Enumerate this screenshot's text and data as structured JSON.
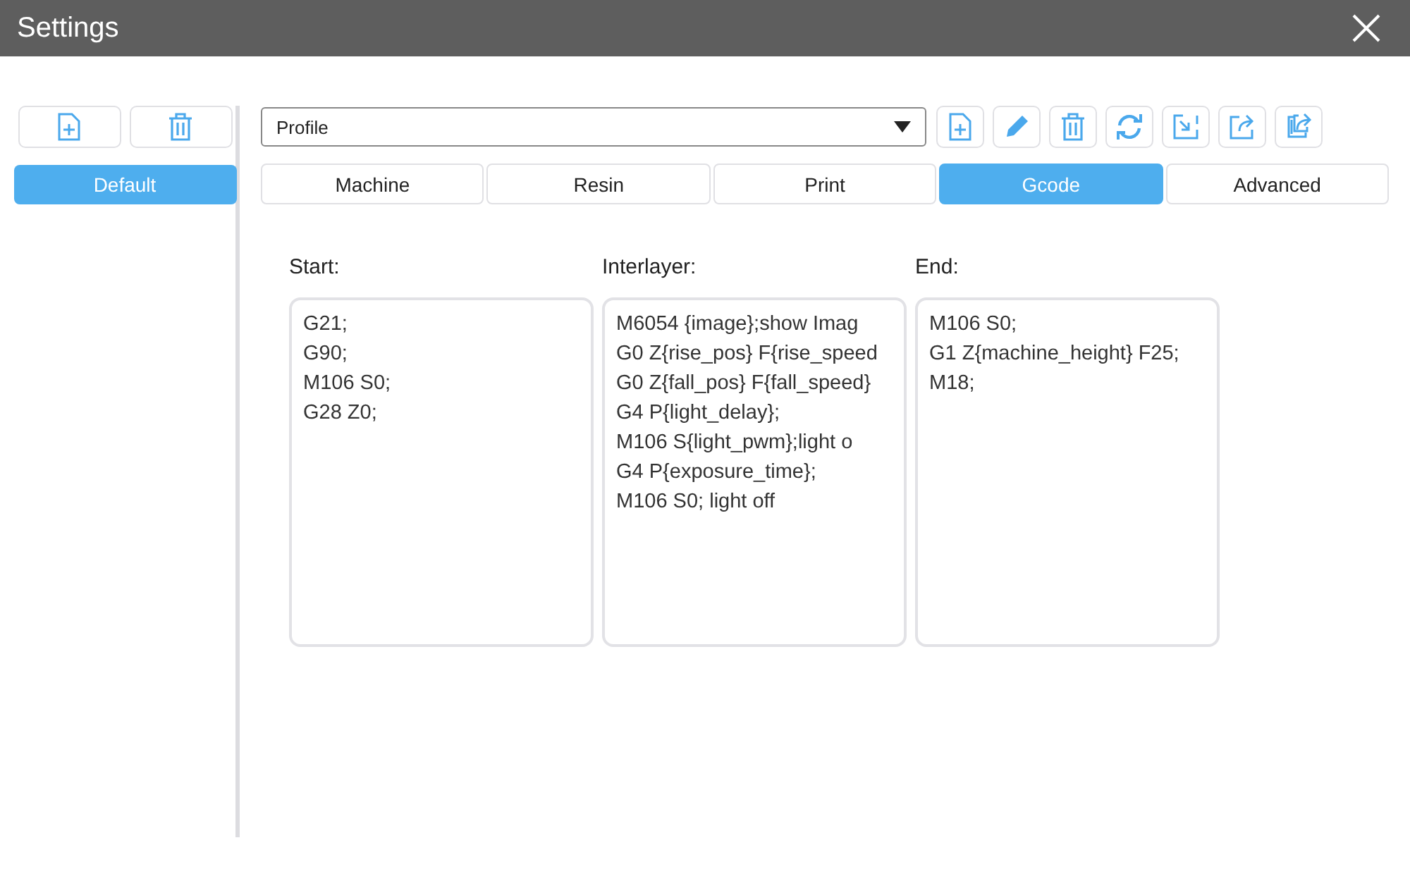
{
  "window": {
    "title": "Settings"
  },
  "sidebar": {
    "items": [
      {
        "label": "Default",
        "selected": true
      }
    ]
  },
  "profile_select": {
    "value": "Profile"
  },
  "tabs": [
    {
      "label": "Machine",
      "selected": false
    },
    {
      "label": "Resin",
      "selected": false
    },
    {
      "label": "Print",
      "selected": false
    },
    {
      "label": "Gcode",
      "selected": true
    },
    {
      "label": "Advanced",
      "selected": false
    }
  ],
  "gcode": [
    {
      "label": "Start:",
      "lines": [
        "G21;",
        "G90;",
        "M106 S0;",
        "G28 Z0;"
      ]
    },
    {
      "label": "Interlayer:",
      "lines": [
        "M6054 {image};show Imag",
        "G0 Z{rise_pos} F{rise_speed",
        "G0 Z{fall_pos} F{fall_speed}",
        "G4 P{light_delay};",
        "M106 S{light_pwm};light o",
        "G4 P{exposure_time};",
        "M106 S0; light off"
      ]
    },
    {
      "label": "End:",
      "lines": [
        "M106 S0;",
        "G1 Z{machine_height} F25;",
        "M18;"
      ]
    }
  ]
}
